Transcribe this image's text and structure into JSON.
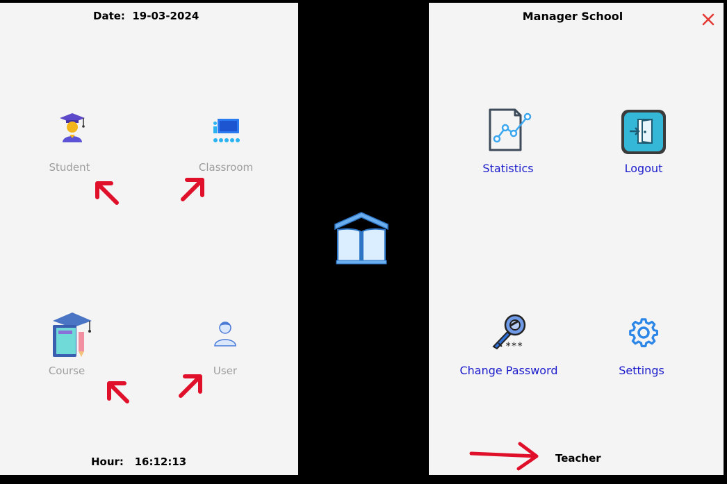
{
  "left": {
    "date_label": "Date:  19-03-2024",
    "hour_label": "Hour:   16:12:13",
    "tiles": [
      {
        "label": "Student",
        "icon": "student-graduate-icon"
      },
      {
        "label": "Classroom",
        "icon": "classroom-icon"
      },
      {
        "label": "Course",
        "icon": "course-books-icon"
      },
      {
        "label": "User",
        "icon": "user-icon"
      }
    ]
  },
  "right": {
    "title": "Manager School",
    "close_icon": "close-icon",
    "menu": [
      {
        "label": "Statistics",
        "icon": "statistics-chart-icon"
      },
      {
        "label": "Logout",
        "icon": "logout-door-icon"
      },
      {
        "label": "Change Password",
        "icon": "key-password-icon"
      },
      {
        "label": "Settings",
        "icon": "gear-icon"
      }
    ],
    "role": "Teacher"
  },
  "colors": {
    "panel_bg": "#f4f4f4",
    "background": "#000000",
    "menu_label": "#1a1acc",
    "tile_label": "#9e9e9e",
    "annotation_arrow": "#e0102a",
    "close": "#e53935"
  }
}
